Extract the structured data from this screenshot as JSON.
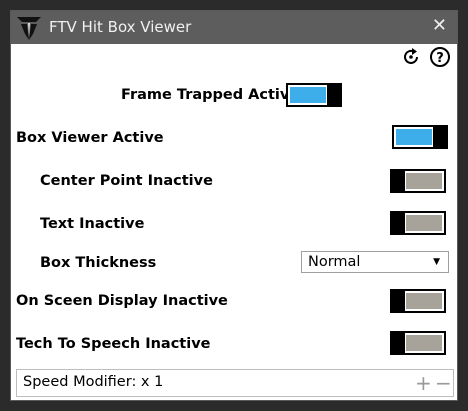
{
  "window": {
    "title": "FTV Hit Box Viewer",
    "close_glyph": "✕",
    "app_icon": "ftv-logo-icon"
  },
  "toolbar": {
    "reset_icon": "refresh-icon",
    "help_icon": "help-icon"
  },
  "settings": {
    "frame_trapped": {
      "label": "Frame Trapped Active",
      "state": "on"
    },
    "box_viewer": {
      "label": "Box Viewer Active",
      "state": "on"
    },
    "center_point": {
      "label": "Center Point Inactive",
      "state": "off"
    },
    "text": {
      "label": "Text Inactive",
      "state": "off"
    },
    "box_thickness": {
      "label": "Box Thickness",
      "value": "Normal"
    },
    "osd": {
      "label": "On Sceen Display Inactive",
      "state": "off"
    },
    "tts": {
      "label": "Tech To Speech Inactive",
      "state": "off"
    }
  },
  "statusbar": {
    "speed_text": "Speed Modifier: x 1",
    "plus": "+",
    "minus": "−"
  },
  "colors": {
    "accent_on": "#3daee9",
    "off_fill": "#a8a39a",
    "titlebar": "#5d5d5d"
  }
}
